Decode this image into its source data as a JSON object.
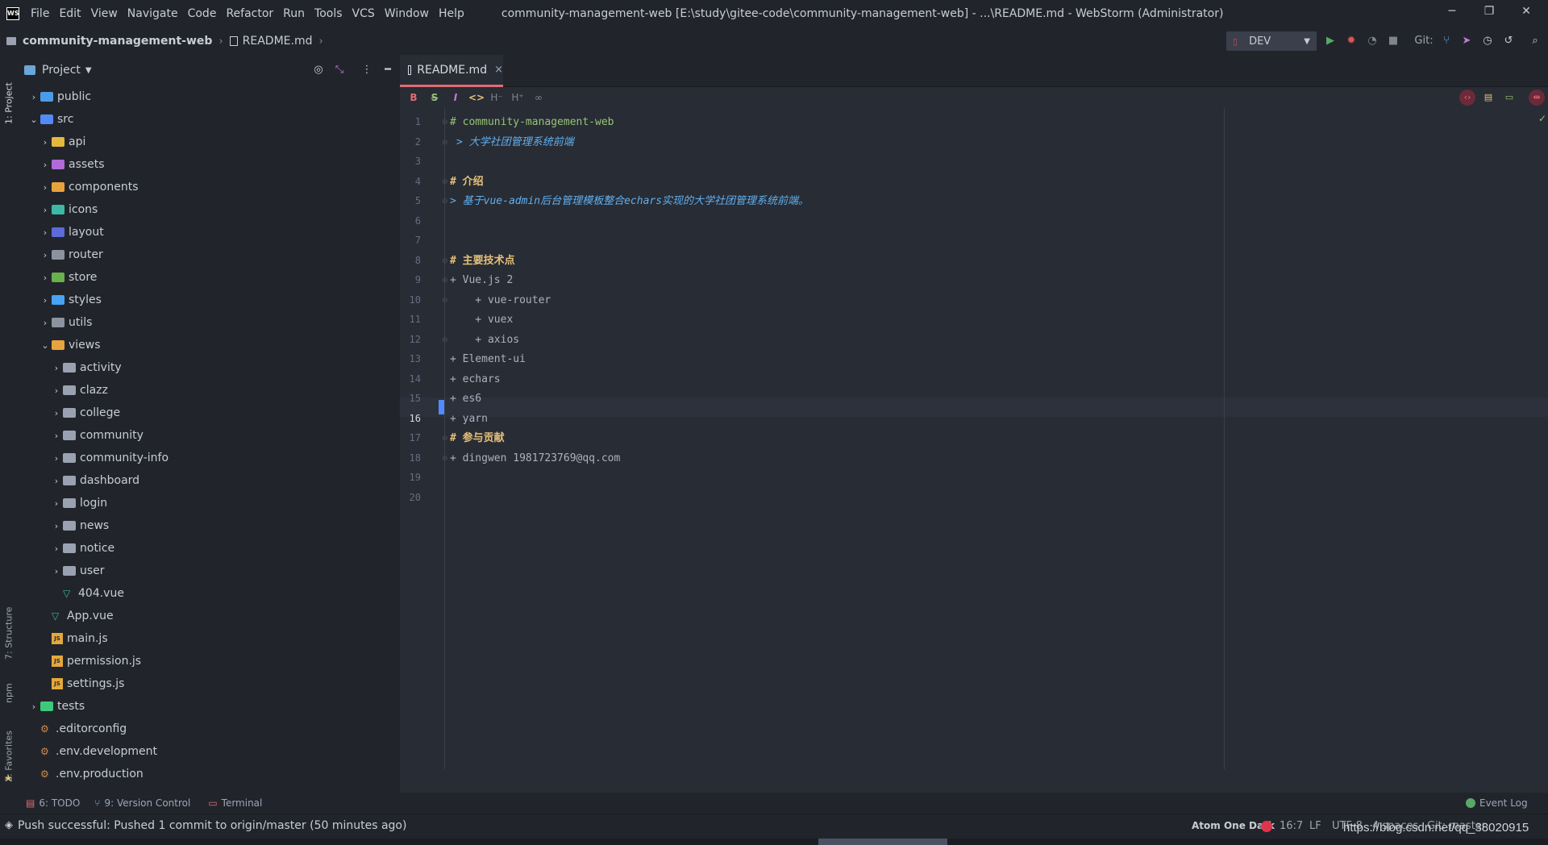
{
  "window": {
    "title": "community-management-web [E:\\study\\gitee-code\\community-management-web] - ...\\README.md - WebStorm (Administrator)",
    "logo_text": "WS",
    "minimize": "─",
    "restore": "❐",
    "close": "✕"
  },
  "menu": [
    "File",
    "Edit",
    "View",
    "Navigate",
    "Code",
    "Refactor",
    "Run",
    "Tools",
    "VCS",
    "Window",
    "Help"
  ],
  "breadcrumb": {
    "project": "community-management-web",
    "file": "README.md"
  },
  "toolbar": {
    "run_config": "DEV",
    "git_label": "Git:"
  },
  "project_panel": {
    "title": "Project",
    "tree": [
      {
        "label": "public",
        "depth": 1,
        "icon": "blue",
        "chevron": "›"
      },
      {
        "label": "src",
        "depth": 1,
        "icon": "src",
        "chevron": "⌄"
      },
      {
        "label": "api",
        "depth": 2,
        "icon": "yellow",
        "chevron": "›"
      },
      {
        "label": "assets",
        "depth": 2,
        "icon": "purple",
        "chevron": "›"
      },
      {
        "label": "components",
        "depth": 2,
        "icon": "orange",
        "chevron": "›"
      },
      {
        "label": "icons",
        "depth": 2,
        "icon": "teal",
        "chevron": "›"
      },
      {
        "label": "layout",
        "depth": 2,
        "icon": "indigo",
        "chevron": "›"
      },
      {
        "label": "router",
        "depth": 2,
        "icon": "gray",
        "chevron": "›"
      },
      {
        "label": "store",
        "depth": 2,
        "icon": "green",
        "chevron": "›"
      },
      {
        "label": "styles",
        "depth": 2,
        "icon": "lightblue",
        "chevron": "›"
      },
      {
        "label": "utils",
        "depth": 2,
        "icon": "gray",
        "chevron": "›"
      },
      {
        "label": "views",
        "depth": 2,
        "icon": "orange",
        "chevron": "⌄"
      },
      {
        "label": "activity",
        "depth": 3,
        "icon": "plain",
        "chevron": "›"
      },
      {
        "label": "clazz",
        "depth": 3,
        "icon": "plain",
        "chevron": "›"
      },
      {
        "label": "college",
        "depth": 3,
        "icon": "plain",
        "chevron": "›"
      },
      {
        "label": "community",
        "depth": 3,
        "icon": "plain",
        "chevron": "›"
      },
      {
        "label": "community-info",
        "depth": 3,
        "icon": "plain",
        "chevron": "›"
      },
      {
        "label": "dashboard",
        "depth": 3,
        "icon": "plain",
        "chevron": "›"
      },
      {
        "label": "login",
        "depth": 3,
        "icon": "plain",
        "chevron": "›"
      },
      {
        "label": "news",
        "depth": 3,
        "icon": "plain",
        "chevron": "›"
      },
      {
        "label": "notice",
        "depth": 3,
        "icon": "plain",
        "chevron": "›"
      },
      {
        "label": "user",
        "depth": 3,
        "icon": "plain",
        "chevron": "›"
      },
      {
        "label": "404.vue",
        "depth": 3,
        "icon": "vue",
        "chevron": ""
      },
      {
        "label": "App.vue",
        "depth": 2,
        "icon": "vue",
        "chevron": ""
      },
      {
        "label": "main.js",
        "depth": 2,
        "icon": "js",
        "chevron": ""
      },
      {
        "label": "permission.js",
        "depth": 2,
        "icon": "js",
        "chevron": ""
      },
      {
        "label": "settings.js",
        "depth": 2,
        "icon": "js",
        "chevron": ""
      },
      {
        "label": "tests",
        "depth": 1,
        "icon": "lime",
        "chevron": "›"
      },
      {
        "label": ".editorconfig",
        "depth": 1,
        "icon": "cfg",
        "chevron": ""
      },
      {
        "label": ".env.development",
        "depth": 1,
        "icon": "cfg",
        "chevron": ""
      },
      {
        "label": ".env.production",
        "depth": 1,
        "icon": "cfg",
        "chevron": ""
      }
    ]
  },
  "left_tool_tabs": {
    "project": "1: Project",
    "structure": "7: Structure",
    "npm": "npm",
    "favorites": "2: Favorites"
  },
  "editor": {
    "tab_label": "README.md",
    "tab_close": "×",
    "current_line": 16,
    "md_buttons": [
      "B",
      "S",
      "I",
      "<>",
      "H⁻",
      "H⁺",
      "∞"
    ],
    "lines": [
      {
        "n": "1",
        "text": "# community-management-web",
        "style": "h"
      },
      {
        "n": "2",
        "text": "> 大学社团管理系统前端",
        "style": "q",
        "indent": 1
      },
      {
        "n": "3",
        "text": "",
        "style": ""
      },
      {
        "n": "4",
        "text": "# 介绍",
        "style": "hc"
      },
      {
        "n": "5",
        "text": "> 基于vue-admin后台管理模板整合echars实现的大学社团管理系统前端。",
        "style": "q"
      },
      {
        "n": "6",
        "text": "",
        "style": ""
      },
      {
        "n": "7",
        "text": "",
        "style": ""
      },
      {
        "n": "8",
        "text": "# 主要技术点",
        "style": "hc"
      },
      {
        "n": "9",
        "text": "+ Vue.js 2",
        "style": ""
      },
      {
        "n": "10",
        "text": "    + vue-router",
        "style": ""
      },
      {
        "n": "11",
        "text": "    + vuex",
        "style": ""
      },
      {
        "n": "12",
        "text": "    + axios",
        "style": ""
      },
      {
        "n": "13",
        "text": "+ Element-ui",
        "style": ""
      },
      {
        "n": "14",
        "text": "+ echars",
        "style": ""
      },
      {
        "n": "15",
        "text": "+ es6",
        "style": ""
      },
      {
        "n": "16",
        "text": "+ yarn",
        "style": ""
      },
      {
        "n": "17",
        "text": "# 参与贡献",
        "style": "hc"
      },
      {
        "n": "18",
        "text": "+ dingwen 1981723769@qq.com",
        "style": ""
      },
      {
        "n": "19",
        "text": "",
        "style": ""
      },
      {
        "n": "20",
        "text": "",
        "style": ""
      }
    ]
  },
  "bottom_tools": {
    "todo": "6: TODO",
    "vcs": "9: Version Control",
    "terminal": "Terminal",
    "event_log": "Event Log"
  },
  "status": {
    "message": "Push successful: Pushed 1 commit to origin/master (50 minutes ago)",
    "theme": "Atom One Dark",
    "position": "16:7",
    "line_sep": "LF",
    "encoding": "UTF-8",
    "indent": "4 spaces",
    "git_branch": "Git: master"
  },
  "watermark": "https://blog.csdn.net/qq_38020915",
  "colors": {
    "accent": "#e06c75",
    "heading": "#98c379",
    "quote": "#61afef",
    "bg_editor": "#282c34",
    "bg_panel": "#21252b"
  }
}
